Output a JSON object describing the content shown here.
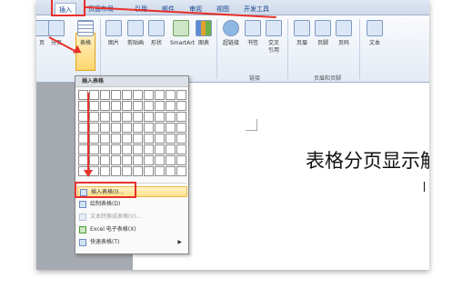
{
  "tabs": [
    {
      "label": "插入"
    },
    {
      "label": "页面布局"
    },
    {
      "label": "引用"
    },
    {
      "label": "邮件"
    },
    {
      "label": "审阅"
    },
    {
      "label": "视图"
    },
    {
      "label": "开发工具"
    }
  ],
  "ribbon": {
    "buttons": [
      {
        "label": "页",
        "icon": "page-icon"
      },
      {
        "label": "分页",
        "icon": "page-break-icon"
      },
      {
        "label": "表格",
        "icon": "table-icon"
      },
      {
        "label": "图片",
        "icon": "picture-icon"
      },
      {
        "label": "剪贴画",
        "icon": "clipart-icon"
      },
      {
        "label": "形状",
        "icon": "shapes-icon"
      },
      {
        "label": "SmartArt",
        "icon": "smartart-icon"
      },
      {
        "label": "图表",
        "icon": "chart-icon"
      },
      {
        "label": "超链接",
        "icon": "hyperlink-icon"
      },
      {
        "label": "书签",
        "icon": "bookmark-icon"
      },
      {
        "label": "交叉\n引用",
        "icon": "cross-reference-icon"
      },
      {
        "label": "页眉",
        "icon": "header-icon"
      },
      {
        "label": "页脚",
        "icon": "footer-icon"
      },
      {
        "label": "页码",
        "icon": "page-number-icon"
      },
      {
        "label": "文本",
        "icon": "textbox-icon"
      }
    ],
    "groups": [
      {
        "label": "链接"
      },
      {
        "label": "页眉和页脚"
      }
    ]
  },
  "table_menu": {
    "header": "插入表格",
    "grid_rows": 8,
    "grid_cols": 10,
    "items": [
      {
        "label": "插入表格(I)...",
        "icon": "insert-table-icon",
        "highlighted": true,
        "disabled": false
      },
      {
        "label": "绘制表格(D)",
        "icon": "draw-table-icon",
        "highlighted": false,
        "disabled": false
      },
      {
        "label": "文本转换成表格(V)...",
        "icon": "convert-text-icon",
        "highlighted": false,
        "disabled": true
      },
      {
        "label": "Excel 电子表格(X)",
        "icon": "excel-icon",
        "highlighted": false,
        "disabled": false
      },
      {
        "label": "快速表格(T)",
        "icon": "quick-table-icon",
        "highlighted": false,
        "disabled": false,
        "submenu": true
      }
    ]
  },
  "document": {
    "title": "表格分页显示解"
  },
  "colors": {
    "annotation": "#e8312a",
    "highlight": "#ffdf8a",
    "ribbon_bg": "#e3ebf6"
  }
}
